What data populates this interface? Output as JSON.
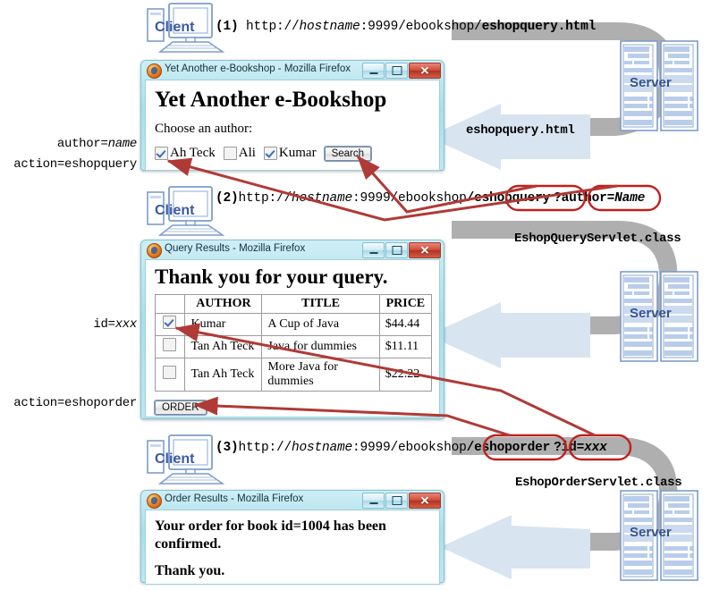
{
  "colors": {
    "red_arrow": "#b03a36",
    "red_circle": "#c0201c",
    "gray_arrow": "#a6a6a6",
    "blue_arrow": "#d6e3f0",
    "client_blue": "#3b5a9e",
    "server_blue": "#36528f",
    "window_frame": "#a8dfeb",
    "close_red": "#cf4b36"
  },
  "icons": {
    "client": "desktop-computer-icon",
    "server": "server-rack-icon",
    "firefox": "firefox-logo-icon",
    "minimize": "minimize-icon",
    "maximize": "maximize-icon",
    "close": "close-icon",
    "checkbox_checked": "checkbox-checked-icon",
    "checkbox_unchecked": "checkbox-unchecked-icon"
  },
  "labels": {
    "client": "Client",
    "server": "Server"
  },
  "steps": {
    "step1": {
      "number": "(1)",
      "url_prefix": "http://",
      "url_host": "hostname",
      "url_mid": ":9999/ebookshop/",
      "url_bold": "eshopquery.html"
    },
    "step2": {
      "number": "(2)",
      "url_prefix": "http://",
      "url_host": "hostname",
      "url_mid": ":9999/ebookshop",
      "url_circle1": "/eshopquery",
      "url_circle2": "?author=Name",
      "url_circle2_plain": "?author=",
      "url_circle2_italic": "Name"
    },
    "step3": {
      "number": "(3)",
      "url_prefix": "http://",
      "url_host": "hostname",
      "url_mid": ":9999/ebookshop",
      "url_circle1": "/eshoporder",
      "url_circle2_plain": "?id=",
      "url_circle2_italic": "xxx"
    }
  },
  "responses": {
    "response1": "eshopquery.html",
    "servlet1": "EshopQueryServlet.class",
    "servlet2": "EshopOrderServlet.class"
  },
  "annotations": {
    "author_name_plain": "author=",
    "author_name_italic": "name",
    "action_eshopquery": "action=eshopquery",
    "id_xxx_plain": "id=",
    "id_xxx_italic": "xxx",
    "action_eshoporder": "action=eshoporder"
  },
  "windows": {
    "query_form": {
      "title": "Yet Another e-Bookshop - Mozilla Firefox",
      "heading": "Yet Another e-Bookshop",
      "prompt": "Choose an author:",
      "checkboxes": [
        {
          "label": "Ah Teck",
          "checked": true
        },
        {
          "label": "Ali",
          "checked": false
        },
        {
          "label": "Kumar",
          "checked": true
        }
      ],
      "submit_label": "Search"
    },
    "query_results": {
      "title": "Query Results - Mozilla Firefox",
      "heading": "Thank you for your query.",
      "table": {
        "headers": [
          "",
          "AUTHOR",
          "TITLE",
          "PRICE"
        ],
        "rows": [
          {
            "checked": true,
            "author": "Kumar",
            "title": "A Cup of Java",
            "price": "$44.44"
          },
          {
            "checked": false,
            "author": "Tan Ah Teck",
            "title": "Java for dummies",
            "price": "$11.11"
          },
          {
            "checked": false,
            "author": "Tan Ah Teck",
            "title": "More Java for dummies",
            "price": "$22.22"
          }
        ]
      },
      "submit_label": "ORDER"
    },
    "order_results": {
      "title": "Order Results - Mozilla Firefox",
      "line1": "Your order for book id=1004 has been",
      "line2": "confirmed.",
      "line3": "Thank you."
    }
  }
}
